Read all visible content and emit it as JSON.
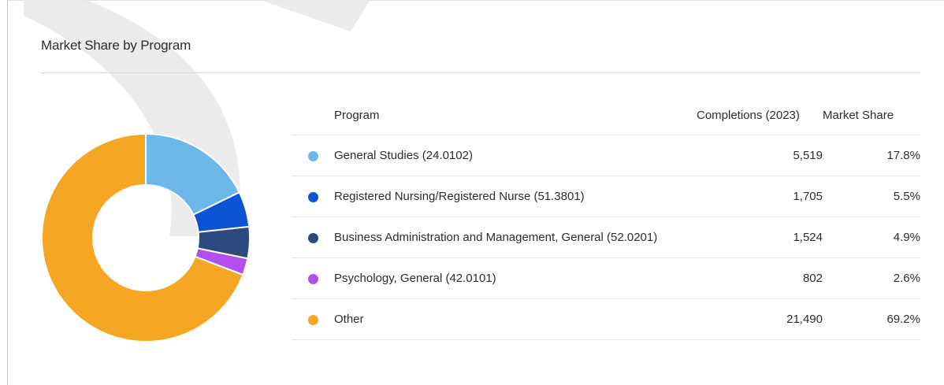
{
  "card": {
    "title": "Market Share by Program"
  },
  "table": {
    "headers": {
      "program": "Program",
      "completions": "Completions (2023)",
      "share": "Market Share"
    }
  },
  "chart_data": {
    "type": "pie",
    "title": "Market Share by Program",
    "donut": true,
    "categories": [
      "General Studies (24.0102)",
      "Registered Nursing/Registered Nurse (51.3801)",
      "Business Administration and Management, General (52.0201)",
      "Psychology, General (42.0101)",
      "Other"
    ],
    "completions": [
      "5,519",
      "1,705",
      "1,524",
      "802",
      "21,490"
    ],
    "shares_label": [
      "17.8%",
      "5.5%",
      "4.9%",
      "2.6%",
      "69.2%"
    ],
    "values": [
      17.8,
      5.5,
      4.9,
      2.6,
      69.2
    ],
    "colors": [
      "#6cb8ea",
      "#0d53d6",
      "#2c4a80",
      "#b24fea",
      "#f5a623"
    ]
  }
}
